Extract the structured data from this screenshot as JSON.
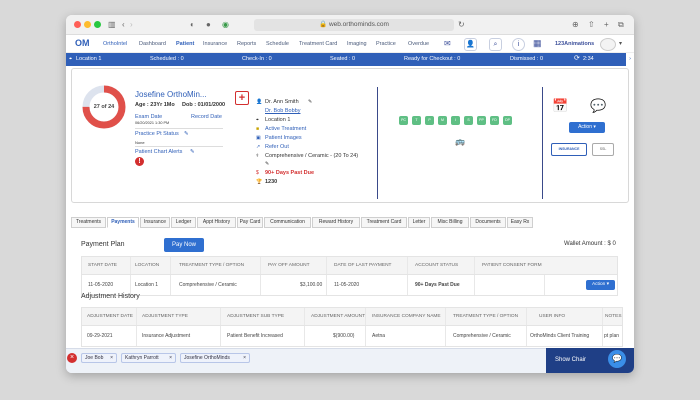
{
  "browser": {
    "url": "web.orthominds.com"
  },
  "nav": {
    "logo": "OM",
    "items": [
      "OrthoIntel",
      "Dashboard",
      "Patient",
      "Insurance",
      "Reports",
      "Schedule",
      "Treatment Card",
      "Imaging",
      "Practice",
      "Overdue"
    ],
    "active": "Patient",
    "user": "123Animations"
  },
  "statusbar": {
    "location": "Location 1",
    "scheduled": "Scheduled : 0",
    "checkin": "Check-In : 0",
    "seated": "Seated : 0",
    "ready": "Ready for Checkout : 0",
    "dismissed": "Dismissed : 0",
    "time": "2:34"
  },
  "patient": {
    "progress_text": "27 of 24",
    "progress_fraction": 0.75,
    "name": "Josefine OrthoMin...",
    "age": "Age : 23Yr 1Mo",
    "dob": "Dob : 01/01/2000",
    "exam_date_label": "Exam Date",
    "exam_date": "06/20/2021 1:30 PM",
    "record_date_label": "Record Date",
    "pt_status_label": "Practice Pt Status",
    "pt_status_value": "None",
    "alerts_label": "Patient Chart Alerts",
    "doctor1": "Dr. Ann Smith",
    "doctor2": "Dr. Bob Bobby",
    "location": "Location 1",
    "treatment_status": "Active Treatment",
    "images": "Patient Images",
    "refer": "Refer Out",
    "treatment_type": "Comprehensive / Ceramic - (20 To 24)",
    "past_due": "90+ Days Past Due",
    "code": "1230"
  },
  "teeth": [
    "PC",
    "T",
    "P",
    "M",
    "I",
    "S",
    "PP",
    "FD",
    "DP"
  ],
  "action_label": "Action",
  "insurance_badge": "INSURANCE",
  "tabs": [
    "Treatments",
    "Payments",
    "Insurance",
    "Ledger",
    "Appt History",
    "Pay Card",
    "Communication",
    "Reward History",
    "Treatment Card",
    "Letter",
    "Misc Billing",
    "Documents",
    "Easy Rx"
  ],
  "active_tab": "Payments",
  "payment_plan": {
    "title": "Payment Plan",
    "pay_now": "Pay Now",
    "wallet": "Wallet Amount : $ 0",
    "headers": [
      "START DATE",
      "LOCATION",
      "TREATMENT TYPE / OPTION",
      "PAY OFF AMOUNT",
      "DATE OF LAST PAYMENT",
      "ACCOUNT STATUS",
      "PATIENT CONSENT FORM"
    ],
    "row": [
      "11-05-2020",
      "Location 1",
      "Comprehensive / Ceramic",
      "$3,100.00",
      "11-05-2020",
      "90+ Days Past Due",
      ""
    ],
    "row_action": "Action"
  },
  "adjustment": {
    "title": "Adjustment History",
    "headers": [
      "ADJUSTMENT DATE",
      "ADJUSTMENT TYPE",
      "ADJUSTMENT SUB TYPE",
      "ADJUSTMENT AMOUNT",
      "INSURANCE COMPANY NAME",
      "TREATMENT TYPE / OPTION",
      "USER INFO",
      "NOTES"
    ],
    "row": [
      "09-29-2021",
      "Insurance Adjustment",
      "Patient Benefit Increased",
      "$(900.00)",
      "Aetna",
      "Comprehensive / Ceramic",
      "OrthoMinds Client Training",
      "pt plan"
    ]
  },
  "footer": {
    "chips": [
      "Joe Bob",
      "Kathryn Parrott",
      "Josefine OrthoMinds"
    ],
    "show_chair": "Show Chair"
  },
  "colors": {
    "brand": "#2f5fb8",
    "accent": "#2f6fd0",
    "danger": "#d32f2f",
    "tooth": "#5fbf84",
    "donut": "#e0504a"
  }
}
